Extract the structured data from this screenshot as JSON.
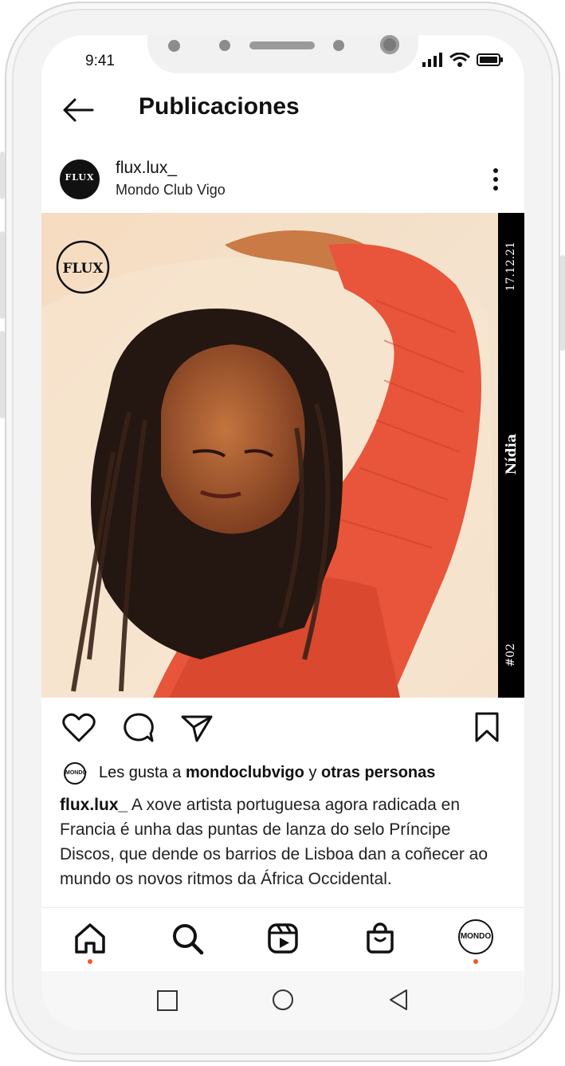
{
  "status_bar": {
    "time": "9:41"
  },
  "header": {
    "title": "Publicaciones"
  },
  "post": {
    "username": "flux.lux_",
    "location": "Mondo Club Vigo",
    "avatar_text": "FLUX",
    "photo": {
      "logo_text": "FLUX",
      "strip_date": "17.12.21",
      "strip_name": "Nídia",
      "strip_number": "#02"
    },
    "likes": {
      "prefix": "Les gusta a",
      "user": "mondoclubvigo",
      "conj": "y",
      "others": "otras personas",
      "avatar_text": "MONDO"
    },
    "caption": {
      "user": "flux.lux_",
      "text": "A xove artista portuguesa agora radicada en Francia é unha das puntas de lanza do selo Príncipe Discos, que dende os barrios de Lisboa dan a coñecer ao mundo os novos ritmos da África Occidental."
    }
  },
  "nav": {
    "profile_avatar_text": "MONDO",
    "accent": "#f05a28"
  },
  "icons": [
    "back-arrow-icon",
    "more-vertical-icon",
    "heart-icon",
    "comment-icon",
    "share-icon",
    "bookmark-icon",
    "home-icon",
    "search-icon",
    "reels-icon",
    "shop-icon",
    "square-icon",
    "circle-icon",
    "triangle-icon"
  ]
}
